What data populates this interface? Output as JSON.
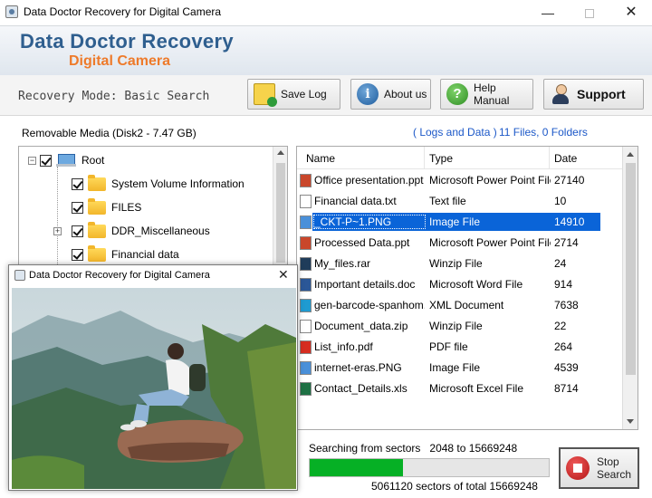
{
  "window": {
    "title": "Data Doctor Recovery for Digital Camera",
    "min_glyph": "—",
    "close_glyph": "✕"
  },
  "banner": {
    "title": "Data Doctor Recovery",
    "subtitle": "Digital Camera"
  },
  "toolbar": {
    "mode_text": "Recovery Mode: Basic Search",
    "save_log": "Save Log",
    "about_us": "About us",
    "help_manual": "Help Manual",
    "support": "Support",
    "about_icon_glyph": "i",
    "help_icon_glyph": "?"
  },
  "info": {
    "media": "Removable Media (Disk2 - 7.47 GB)",
    "logs_link": "( Logs and Data )",
    "files_count": "11 Files, 0 Folders"
  },
  "tree": {
    "root": "Root",
    "items": [
      {
        "label": "System Volume Information"
      },
      {
        "label": "FILES"
      },
      {
        "label": "DDR_Miscellaneous"
      },
      {
        "label": "Financial data"
      }
    ],
    "expand_minus": "−",
    "expand_plus": "+"
  },
  "file_list": {
    "columns": {
      "name": "Name",
      "type": "Type",
      "date": "Date"
    },
    "rows": [
      {
        "name": "Office presentation.ppt",
        "type": "Microsoft Power Point File",
        "date": "27140",
        "icon": "ppt-icon",
        "color": "#c9472b"
      },
      {
        "name": "Financial data.txt",
        "type": "Text file",
        "date": "10",
        "icon": "txt-icon",
        "color": "#ffffff"
      },
      {
        "name": "_CKT-P~1.PNG",
        "type": "Image File",
        "date": "14910",
        "icon": "image-icon",
        "color": "#4a90d9"
      },
      {
        "name": "Processed Data.ppt",
        "type": "Microsoft Power Point File",
        "date": "2714",
        "icon": "ppt-icon",
        "color": "#c9472b"
      },
      {
        "name": "My_files.rar",
        "type": "Winzip File",
        "date": "24",
        "icon": "ps-icon",
        "color": "#1f3c5a"
      },
      {
        "name": "Important details.doc",
        "type": "Microsoft Word File",
        "date": "914",
        "icon": "word-icon",
        "color": "#2b5797"
      },
      {
        "name": "gen-barcode-spanhom...",
        "type": "XML Document",
        "date": "7638",
        "icon": "edge-icon",
        "color": "#1f9bd1"
      },
      {
        "name": "Document_data.zip",
        "type": "Winzip File",
        "date": "22",
        "icon": "zip-icon",
        "color": "#ffffff"
      },
      {
        "name": "List_info.pdf",
        "type": "PDF file",
        "date": "264",
        "icon": "pdf-icon",
        "color": "#d62d20"
      },
      {
        "name": "internet-eras.PNG",
        "type": "Image File",
        "date": "4539",
        "icon": "image-icon",
        "color": "#4a90d9"
      },
      {
        "name": "Contact_Details.xls",
        "type": "Microsoft Excel File",
        "date": "8714",
        "icon": "excel-icon",
        "color": "#1e7145"
      }
    ],
    "selected_index": 2
  },
  "progress": {
    "label_prefix": "Searching from sectors",
    "range": "2048 to 15669248",
    "sectors_text": "5061120  sectors  of  total 15669248",
    "fraction": 0.39,
    "stop_label": "Stop Search"
  },
  "preview": {
    "title": "Data Doctor Recovery for Digital Camera",
    "close_glyph": "✕"
  },
  "colors": {
    "brand_blue": "#2f5f8f",
    "brand_orange": "#ee7a2a",
    "link_blue": "#1c58c8",
    "selection": "#0a64d8",
    "progress_green": "#06b025"
  }
}
